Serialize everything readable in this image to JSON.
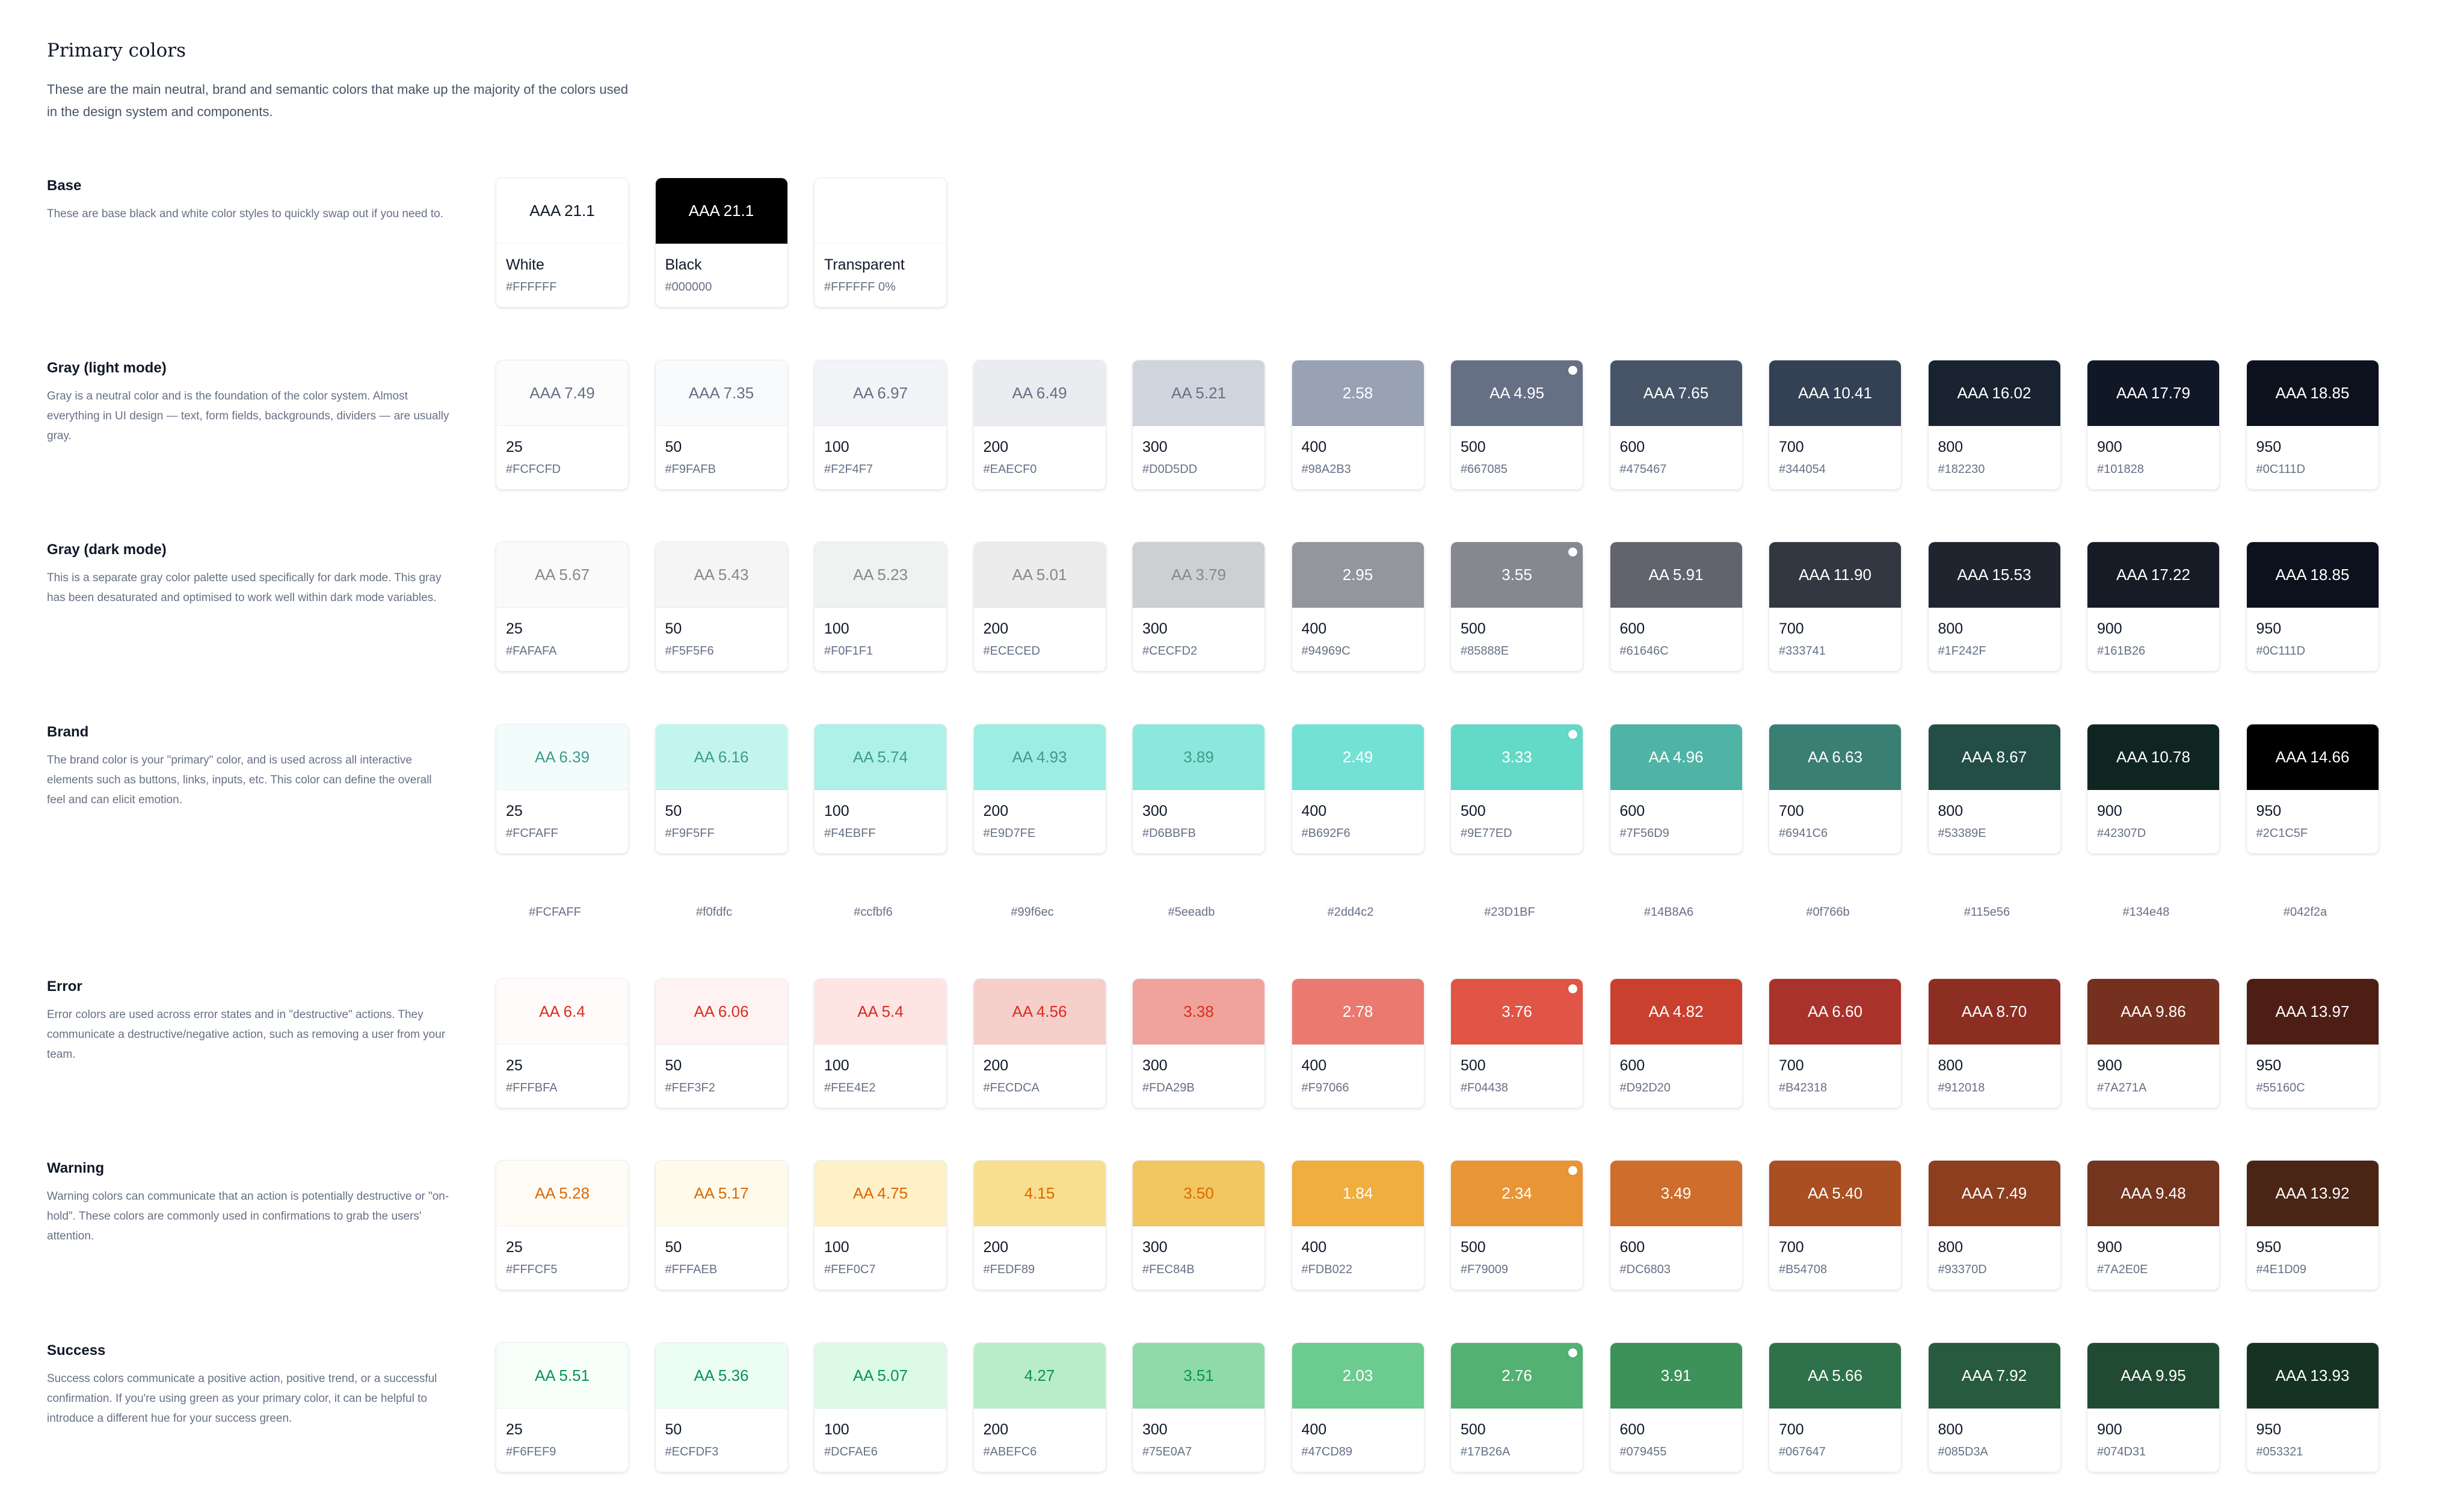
{
  "page": {
    "title": "Primary colors",
    "description": "These are the main neutral, brand and semantic colors that make up the majority of the colors used in the design system and components."
  },
  "groups": [
    {
      "title": "Base",
      "description": "These are base black and white color styles to quickly swap out if you need to.",
      "swatches": [
        {
          "rating": "AAA 21.1",
          "name": "White",
          "hex": "#FFFFFF",
          "color": "#FFFFFF",
          "text_color": "#101828"
        },
        {
          "rating": "AAA 21.1",
          "name": "Black",
          "hex": "#000000",
          "color": "#000000",
          "text_color": "#FFFFFF"
        },
        {
          "rating": "",
          "name": "Transparent",
          "hex": "#FFFFFF 0%",
          "color": "#FFFFFF",
          "text_color": "#101828"
        }
      ]
    },
    {
      "title": "Gray (light mode)",
      "description": "Gray is a neutral color and is the foundation of the color system. Almost everything in UI design — text, form fields, backgrounds, dividers — are usually gray.",
      "swatches": [
        {
          "rating": "AAA 7.49",
          "name": "25",
          "hex": "#FCFCFD",
          "color": "#FCFCFD",
          "text_color": "#667085"
        },
        {
          "rating": "AAA 7.35",
          "name": "50",
          "hex": "#F9FAFB",
          "color": "#F9FAFB",
          "text_color": "#667085"
        },
        {
          "rating": "AA 6.97",
          "name": "100",
          "hex": "#F2F4F7",
          "color": "#F2F4F7",
          "text_color": "#667085"
        },
        {
          "rating": "AA 6.49",
          "name": "200",
          "hex": "#EAECF0",
          "color": "#EAECF0",
          "text_color": "#667085"
        },
        {
          "rating": "AA 5.21",
          "name": "300",
          "hex": "#D0D5DD",
          "color": "#D0D5DD",
          "text_color": "#667085"
        },
        {
          "rating": "2.58",
          "name": "400",
          "hex": "#98A2B3",
          "color": "#98A2B3",
          "text_color": "#FFFFFF"
        },
        {
          "rating": "AA 4.95",
          "name": "500",
          "hex": "#667085",
          "color": "#667085",
          "text_color": "#FFFFFF",
          "primary": true
        },
        {
          "rating": "AAA 7.65",
          "name": "600",
          "hex": "#475467",
          "color": "#475467",
          "text_color": "#FFFFFF"
        },
        {
          "rating": "AAA 10.41",
          "name": "700",
          "hex": "#344054",
          "color": "#344054",
          "text_color": "#FFFFFF"
        },
        {
          "rating": "AAA 16.02",
          "name": "800",
          "hex": "#182230",
          "color": "#182230",
          "text_color": "#FFFFFF"
        },
        {
          "rating": "AAA 17.79",
          "name": "900",
          "hex": "#101828",
          "color": "#101828",
          "text_color": "#FFFFFF"
        },
        {
          "rating": "AAA 18.85",
          "name": "950",
          "hex": "#0C111D",
          "color": "#0C111D",
          "text_color": "#FFFFFF"
        }
      ]
    },
    {
      "title": "Gray (dark mode)",
      "description": "This is a separate gray color palette used specifically for dark mode. This gray has been desaturated and optimised to work well within dark mode variables.",
      "swatches": [
        {
          "rating": "AA 5.67",
          "name": "25",
          "hex": "#FAFAFA",
          "color": "#FAFAFA",
          "text_color": "#85888E"
        },
        {
          "rating": "AA 5.43",
          "name": "50",
          "hex": "#F5F5F6",
          "color": "#F5F5F6",
          "text_color": "#85888E"
        },
        {
          "rating": "AA 5.23",
          "name": "100",
          "hex": "#F0F1F1",
          "color": "#F0F1F1",
          "text_color": "#85888E"
        },
        {
          "rating": "AA 5.01",
          "name": "200",
          "hex": "#ECECED",
          "color": "#ECECED",
          "text_color": "#85888E"
        },
        {
          "rating": "AA 3.79",
          "name": "300",
          "hex": "#CECFD2",
          "color": "#CECFD2",
          "text_color": "#85888E"
        },
        {
          "rating": "2.95",
          "name": "400",
          "hex": "#94969C",
          "color": "#94969C",
          "text_color": "#FFFFFF"
        },
        {
          "rating": "3.55",
          "name": "500",
          "hex": "#85888E",
          "color": "#85888E",
          "text_color": "#FFFFFF",
          "primary": true
        },
        {
          "rating": "AA 5.91",
          "name": "600",
          "hex": "#61646C",
          "color": "#61646C",
          "text_color": "#FFFFFF"
        },
        {
          "rating": "AAA 11.90",
          "name": "700",
          "hex": "#333741",
          "color": "#333741",
          "text_color": "#FFFFFF"
        },
        {
          "rating": "AAA 15.53",
          "name": "800",
          "hex": "#1F242F",
          "color": "#1F242F",
          "text_color": "#FFFFFF"
        },
        {
          "rating": "AAA 17.22",
          "name": "900",
          "hex": "#161B26",
          "color": "#161B26",
          "text_color": "#FFFFFF"
        },
        {
          "rating": "AAA 18.85",
          "name": "950",
          "hex": "#0C111D",
          "color": "#0C111D",
          "text_color": "#FFFFFF"
        }
      ]
    },
    {
      "title": "Brand",
      "description": "The brand color is your \"primary\" color, and is used across all interactive elements such as buttons, links, inputs, etc. This color can define the overall feel and can elicit emotion.",
      "swatches": [
        {
          "rating": "AA 6.39",
          "name": "25",
          "hex": "#FCFAFF",
          "color": "#F2FCFB",
          "text_color": "#3E9C8C"
        },
        {
          "rating": "AA 6.16",
          "name": "50",
          "hex": "#F9F5FF",
          "color": "#C3F5EF",
          "text_color": "#3E9C8C"
        },
        {
          "rating": "AA 5.74",
          "name": "100",
          "hex": "#F4EBFF",
          "color": "#ADF1E9",
          "text_color": "#3E9C8C"
        },
        {
          "rating": "AA 4.93",
          "name": "200",
          "hex": "#E9D7FE",
          "color": "#9CEDE2",
          "text_color": "#3E9C8C"
        },
        {
          "rating": "3.89",
          "name": "300",
          "hex": "#D6BBFB",
          "color": "#8AE8DC",
          "text_color": "#3E9C8C"
        },
        {
          "rating": "2.49",
          "name": "400",
          "hex": "#B692F6",
          "color": "#73E2D5",
          "text_color": "#FFFFFF"
        },
        {
          "rating": "3.33",
          "name": "500",
          "hex": "#9E77ED",
          "color": "#63D9C8",
          "text_color": "#FFFFFF",
          "primary": true
        },
        {
          "rating": "AA 4.96",
          "name": "600",
          "hex": "#7F56D9",
          "color": "#4FB4A5",
          "text_color": "#FFFFFF"
        },
        {
          "rating": "AA 6.63",
          "name": "700",
          "hex": "#6941C6",
          "color": "#3A7F73",
          "text_color": "#FFFFFF"
        },
        {
          "rating": "AAA 8.67",
          "name": "800",
          "hex": "#53389E",
          "color": "#224E46",
          "text_color": "#FFFFFF"
        },
        {
          "rating": "AAA 10.78",
          "name": "900",
          "hex": "#42307D",
          "color": "#0F2522",
          "text_color": "#FFFFFF"
        },
        {
          "rating": "AAA 14.66",
          "name": "950",
          "hex": "#2C1C5F",
          "color": "#000000",
          "text_color": "#FFFFFF"
        }
      ],
      "extra_hex": [
        "#FCFAFF",
        "#f0fdfc",
        "#ccfbf6",
        "#99f6ec",
        "#5eeadb",
        "#2dd4c2",
        "#23D1BF",
        "#14B8A6",
        "#0f766b",
        "#115e56",
        "#134e48",
        "#042f2a"
      ]
    },
    {
      "title": "Error",
      "description": "Error colors are used across error states and in \"destructive\" actions. They communicate a destructive/negative action, such as removing a user from your team.",
      "swatches": [
        {
          "rating": "AA 6.4",
          "name": "25",
          "hex": "#FFFBFA",
          "color": "#FFFBFA",
          "text_color": "#D92D20"
        },
        {
          "rating": "AA 6.06",
          "name": "50",
          "hex": "#FEF3F2",
          "color": "#FEF3F2",
          "text_color": "#D92D20"
        },
        {
          "rating": "AA 5.4",
          "name": "100",
          "hex": "#FEE4E2",
          "color": "#FEE4E2",
          "text_color": "#D92D20"
        },
        {
          "rating": "AA 4.56",
          "name": "200",
          "hex": "#FECDCA",
          "color": "#F6CECA",
          "text_color": "#D92D20"
        },
        {
          "rating": "3.38",
          "name": "300",
          "hex": "#FDA29B",
          "color": "#F0A39C",
          "text_color": "#D92D20"
        },
        {
          "rating": "2.78",
          "name": "400",
          "hex": "#F97066",
          "color": "#EA7A70",
          "text_color": "#FFFFFF"
        },
        {
          "rating": "3.76",
          "name": "500",
          "hex": "#F04438",
          "color": "#E05545",
          "text_color": "#FFFFFF",
          "primary": true
        },
        {
          "rating": "AA 4.82",
          "name": "600",
          "hex": "#D92D20",
          "color": "#C9402E",
          "text_color": "#FFFFFF"
        },
        {
          "rating": "AA 6.60",
          "name": "700",
          "hex": "#B42318",
          "color": "#A9322A",
          "text_color": "#FFFFFF"
        },
        {
          "rating": "AAA 8.70",
          "name": "800",
          "hex": "#912018",
          "color": "#8C2E22",
          "text_color": "#FFFFFF"
        },
        {
          "rating": "AAA 9.86",
          "name": "900",
          "hex": "#7A271A",
          "color": "#76301F",
          "text_color": "#FFFFFF"
        },
        {
          "rating": "AAA 13.97",
          "name": "950",
          "hex": "#55160C",
          "color": "#4E1E15",
          "text_color": "#FFFFFF"
        }
      ]
    },
    {
      "title": "Warning",
      "description": "Warning colors can communicate that an action is potentially destructive or \"on-hold\". These colors are commonly used in confirmations to grab the users' attention.",
      "swatches": [
        {
          "rating": "AA 5.28",
          "name": "25",
          "hex": "#FFFCF5",
          "color": "#FFFCF5",
          "text_color": "#DC6803"
        },
        {
          "rating": "AA 5.17",
          "name": "50",
          "hex": "#FFFAEB",
          "color": "#FFFAEB",
          "text_color": "#DC6803"
        },
        {
          "rating": "AA 4.75",
          "name": "100",
          "hex": "#FEF0C7",
          "color": "#FEF0C7",
          "text_color": "#DC6803"
        },
        {
          "rating": "4.15",
          "name": "200",
          "hex": "#FEDF89",
          "color": "#F8DF8F",
          "text_color": "#DC6803"
        },
        {
          "rating": "3.50",
          "name": "300",
          "hex": "#FEC84B",
          "color": "#F2C660",
          "text_color": "#DC6803"
        },
        {
          "rating": "1.84",
          "name": "400",
          "hex": "#FDB022",
          "color": "#F0AE3E",
          "text_color": "#FFFFFF"
        },
        {
          "rating": "2.34",
          "name": "500",
          "hex": "#F79009",
          "color": "#E89535",
          "text_color": "#FFFFFF",
          "primary": true
        },
        {
          "rating": "3.49",
          "name": "600",
          "hex": "#DC6803",
          "color": "#CF6E2C",
          "text_color": "#FFFFFF"
        },
        {
          "rating": "AA 5.40",
          "name": "700",
          "hex": "#B54708",
          "color": "#AA4F22",
          "text_color": "#FFFFFF"
        },
        {
          "rating": "AAA 7.49",
          "name": "800",
          "hex": "#93370D",
          "color": "#8C3E1E",
          "text_color": "#FFFFFF"
        },
        {
          "rating": "AAA 9.48",
          "name": "900",
          "hex": "#7A2E0E",
          "color": "#74351E",
          "text_color": "#FFFFFF"
        },
        {
          "rating": "AAA 13.92",
          "name": "950",
          "hex": "#4E1D09",
          "color": "#4A2414",
          "text_color": "#FFFFFF"
        }
      ]
    },
    {
      "title": "Success",
      "description": "Success colors communicate a positive action, positive trend, or a successful confirmation. If you're using green as your primary color, it can be helpful to introduce a different hue for your success green.",
      "swatches": [
        {
          "rating": "AA 5.51",
          "name": "25",
          "hex": "#F6FEF9",
          "color": "#F6FEF9",
          "text_color": "#079455"
        },
        {
          "rating": "AA 5.36",
          "name": "50",
          "hex": "#ECFDF3",
          "color": "#ECFDF3",
          "text_color": "#079455"
        },
        {
          "rating": "AA 5.07",
          "name": "100",
          "hex": "#DCFAE6",
          "color": "#DCFAE6",
          "text_color": "#079455"
        },
        {
          "rating": "4.27",
          "name": "200",
          "hex": "#ABEFC6",
          "color": "#B9EDC9",
          "text_color": "#079455"
        },
        {
          "rating": "3.51",
          "name": "300",
          "hex": "#75E0A7",
          "color": "#8EDBA9",
          "text_color": "#079455"
        },
        {
          "rating": "2.03",
          "name": "400",
          "hex": "#47CD89",
          "color": "#6CCB8E",
          "text_color": "#FFFFFF"
        },
        {
          "rating": "2.76",
          "name": "500",
          "hex": "#17B26A",
          "color": "#52B173",
          "text_color": "#FFFFFF",
          "primary": true
        },
        {
          "rating": "3.91",
          "name": "600",
          "hex": "#079455",
          "color": "#3D925A",
          "text_color": "#FFFFFF"
        },
        {
          "rating": "AA 5.66",
          "name": "700",
          "hex": "#067647",
          "color": "#2E714A",
          "text_color": "#FFFFFF"
        },
        {
          "rating": "AAA 7.92",
          "name": "800",
          "hex": "#085D3A",
          "color": "#285B3D",
          "text_color": "#FFFFFF"
        },
        {
          "rating": "AAA 9.95",
          "name": "900",
          "hex": "#074D31",
          "color": "#214A33",
          "text_color": "#FFFFFF"
        },
        {
          "rating": "AAA 13.93",
          "name": "950",
          "hex": "#053321",
          "color": "#163222",
          "text_color": "#FFFFFF"
        }
      ]
    }
  ]
}
